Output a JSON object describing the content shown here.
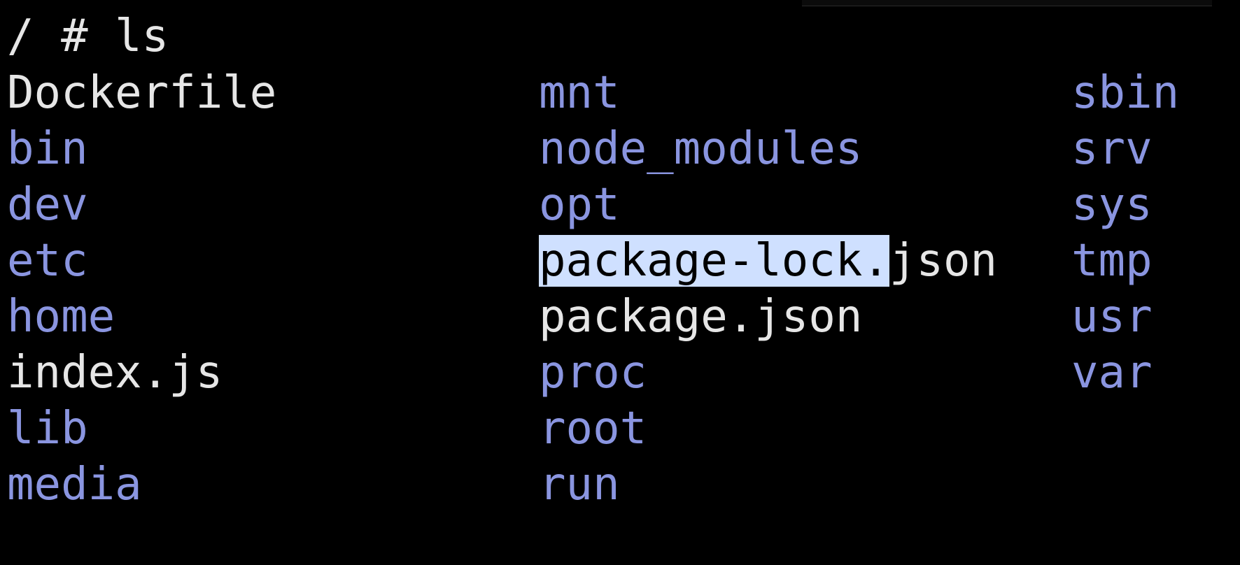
{
  "terminal": {
    "prompt": "/ # ls",
    "columns": [
      [
        {
          "name": "Dockerfile",
          "type": "file"
        },
        {
          "name": "bin",
          "type": "dir"
        },
        {
          "name": "dev",
          "type": "dir"
        },
        {
          "name": "etc",
          "type": "dir"
        },
        {
          "name": "home",
          "type": "dir"
        },
        {
          "name": "index.js",
          "type": "file"
        },
        {
          "name": "lib",
          "type": "dir"
        },
        {
          "name": "media",
          "type": "dir"
        }
      ],
      [
        {
          "name": "mnt",
          "type": "dir"
        },
        {
          "name": "node_modules",
          "type": "dir"
        },
        {
          "name": "opt",
          "type": "dir"
        },
        {
          "name": "package-lock.json",
          "type": "file",
          "selected_part": "package-lock.",
          "rest_part": "json"
        },
        {
          "name": "package.json",
          "type": "file"
        },
        {
          "name": "proc",
          "type": "dir"
        },
        {
          "name": "root",
          "type": "dir"
        },
        {
          "name": "run",
          "type": "dir"
        }
      ],
      [
        {
          "name": "sbin",
          "type": "dir"
        },
        {
          "name": "srv",
          "type": "dir"
        },
        {
          "name": "sys",
          "type": "dir"
        },
        {
          "name": "tmp",
          "type": "dir"
        },
        {
          "name": "usr",
          "type": "dir"
        },
        {
          "name": "var",
          "type": "dir"
        }
      ]
    ],
    "colors": {
      "background": "#000000",
      "directory": "#8a95e0",
      "file": "#e6e6e6",
      "selection": "#cfe0ff"
    }
  }
}
